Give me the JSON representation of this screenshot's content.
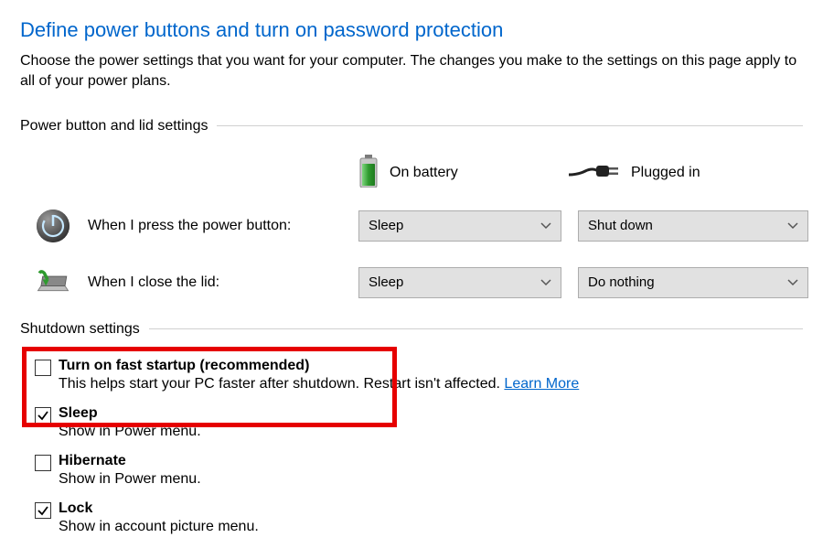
{
  "title": "Define power buttons and turn on password protection",
  "description": "Choose the power settings that you want for your computer. The changes you make to the settings on this page apply to all of your power plans.",
  "section1": {
    "title": "Power button and lid settings",
    "columns": {
      "battery": "On battery",
      "plugged": "Plugged in"
    },
    "rows": {
      "power_button": {
        "label": "When I press the power button:",
        "battery_value": "Sleep",
        "plugged_value": "Shut down"
      },
      "close_lid": {
        "label": "When I close the lid:",
        "battery_value": "Sleep",
        "plugged_value": "Do nothing"
      }
    }
  },
  "section2": {
    "title": "Shutdown settings",
    "items": {
      "fast_startup": {
        "checked": false,
        "label": "Turn on fast startup (recommended)",
        "desc": "This helps start your PC faster after shutdown. Restart isn't affected. ",
        "link": "Learn More"
      },
      "sleep": {
        "checked": true,
        "label": "Sleep",
        "desc": "Show in Power menu."
      },
      "hibernate": {
        "checked": false,
        "label": "Hibernate",
        "desc": "Show in Power menu."
      },
      "lock": {
        "checked": true,
        "label": "Lock",
        "desc": "Show in account picture menu."
      }
    }
  }
}
